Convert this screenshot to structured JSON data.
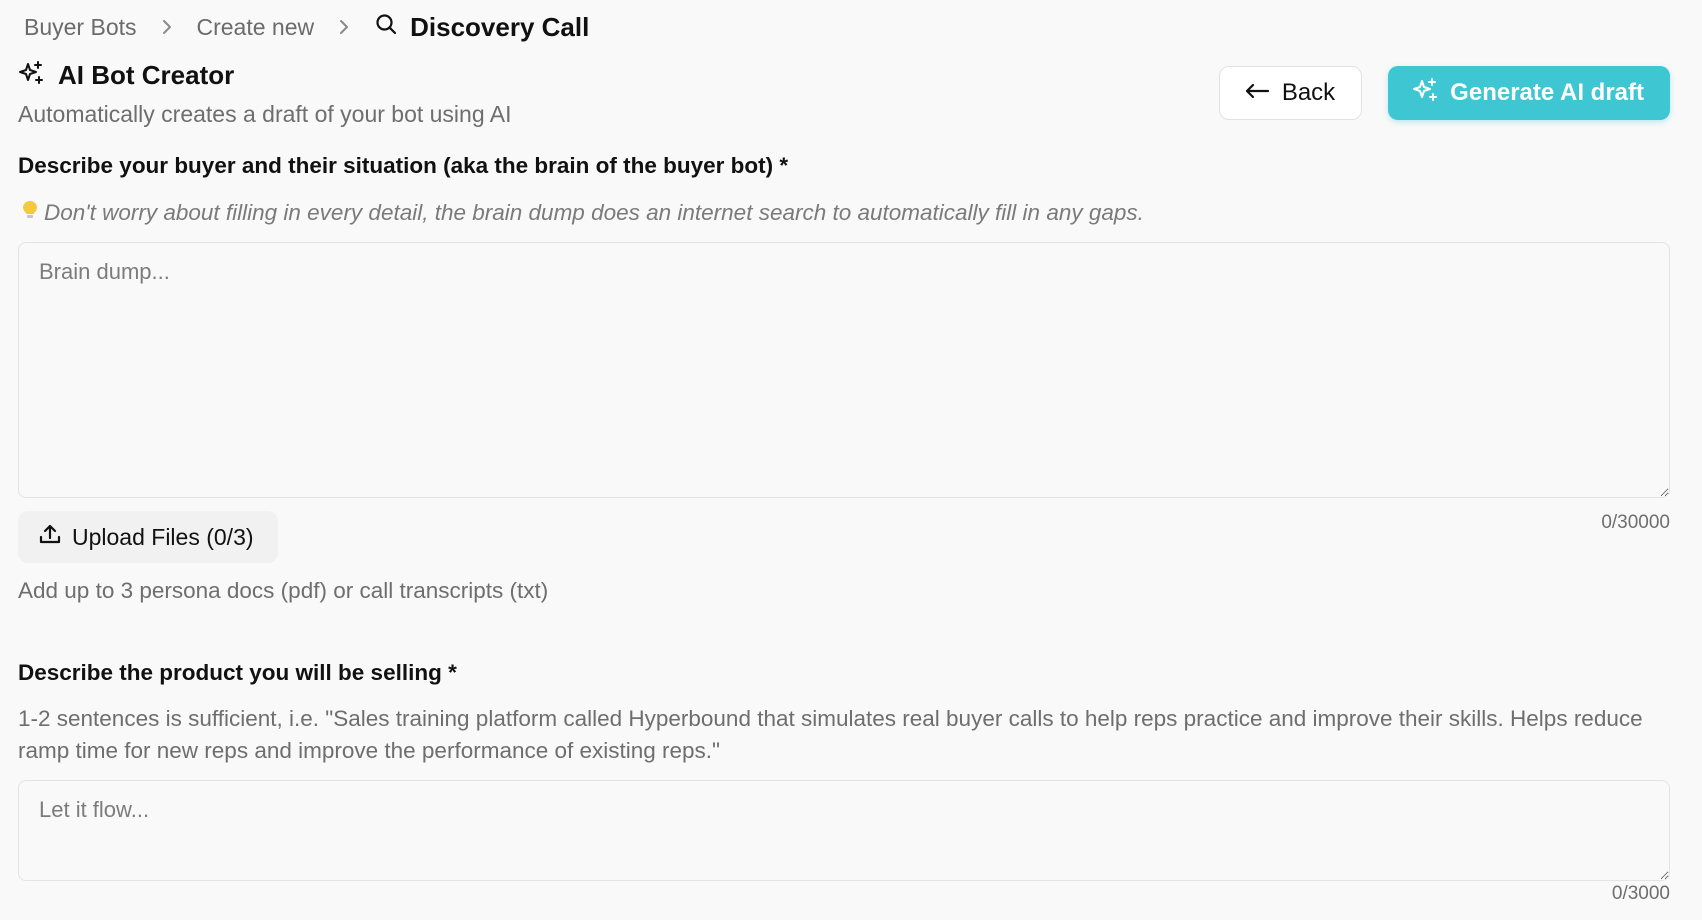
{
  "breadcrumb": {
    "items": [
      "Buyer Bots",
      "Create new"
    ],
    "current": "Discovery Call"
  },
  "header": {
    "title": "AI Bot Creator",
    "subtitle": "Automatically creates a draft of your bot using AI",
    "back_label": "Back",
    "generate_label": "Generate AI draft"
  },
  "buyer": {
    "label": "Describe your buyer and their situation (aka the brain of the buyer bot) *",
    "hint": "Don't worry about filling in every detail, the brain dump does an internet search to automatically fill in any gaps.",
    "placeholder": "Brain dump...",
    "value": "",
    "counter": "0/30000",
    "upload_label": "Upload Files (0/3)",
    "upload_note": "Add up to 3 persona docs (pdf) or call transcripts (txt)"
  },
  "product": {
    "label": "Describe the product you will be selling *",
    "description": "1-2 sentences is sufficient, i.e. \"Sales training platform called Hyperbound that simulates real buyer calls to help reps practice and improve their skills. Helps reduce ramp time for new reps and improve the performance of existing reps.\"",
    "placeholder": "Let it flow...",
    "value": "",
    "counter": "0/3000"
  },
  "colors": {
    "accent": "#3ec6d3",
    "bulb": "#f5c842"
  },
  "icons": {
    "sparkles": "sparkles-icon",
    "search": "search-icon",
    "back": "arrow-left-icon",
    "upload": "upload-icon",
    "bulb": "lightbulb-icon"
  }
}
